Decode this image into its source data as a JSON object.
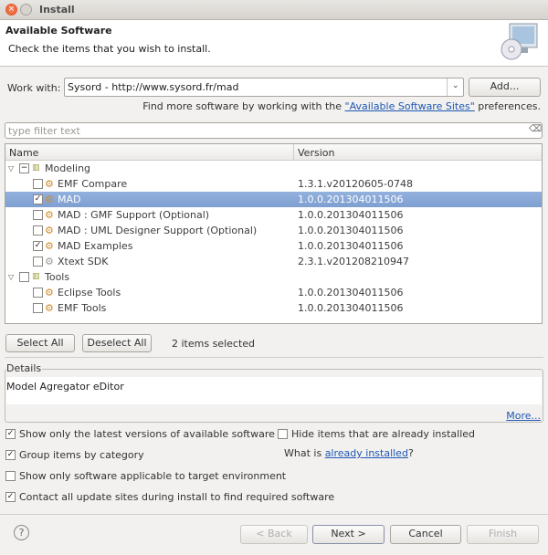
{
  "window": {
    "title": "Install"
  },
  "header": {
    "title": "Available Software",
    "description": "Check the items that you wish to install.",
    "icon": "install-cd-monitor-icon"
  },
  "work_with": {
    "label": "Work with:",
    "value": "Sysord - http://www.sysord.fr/mad",
    "add_label": "Add...",
    "find_more_prefix": "Find more software by working with the ",
    "find_more_link": "\"Available Software Sites\"",
    "find_more_suffix": " preferences."
  },
  "filter": {
    "placeholder": "type filter text"
  },
  "table": {
    "columns": [
      "Name",
      "Version"
    ],
    "rows": [
      {
        "name": "Modeling",
        "version": "",
        "type": "category",
        "checked": "partial",
        "expanded": true
      },
      {
        "name": "EMF Compare",
        "version": "1.3.1.v20120605-0748",
        "checked": false
      },
      {
        "name": "MAD",
        "version": "1.0.0.201304011506",
        "checked": true,
        "selected": true
      },
      {
        "name": "MAD : GMF Support (Optional)",
        "version": "1.0.0.201304011506",
        "checked": false
      },
      {
        "name": "MAD : UML Designer Support (Optional)",
        "version": "1.0.0.201304011506",
        "checked": false
      },
      {
        "name": "MAD Examples",
        "version": "1.0.0.201304011506",
        "checked": true
      },
      {
        "name": "Xtext SDK",
        "version": "2.3.1.v201208210947",
        "checked": false
      },
      {
        "name": "Tools",
        "version": "",
        "type": "category",
        "checked": false,
        "expanded": true
      },
      {
        "name": "Eclipse Tools",
        "version": "1.0.0.201304011506",
        "checked": false
      },
      {
        "name": "EMF Tools",
        "version": "1.0.0.201304011506",
        "checked": false
      }
    ]
  },
  "selection": {
    "select_all": "Select All",
    "deselect_all": "Deselect All",
    "status": "2 items selected"
  },
  "details": {
    "label": "Details",
    "text": "Model Agregator eDitor",
    "more": "More..."
  },
  "options": {
    "latest": {
      "label": "Show only the latest versions of available software",
      "checked": true
    },
    "group": {
      "label": "Group items by category",
      "checked": true
    },
    "target": {
      "label": "Show only software applicable to target environment",
      "checked": false
    },
    "contact": {
      "label": "Contact all update sites during install to find required software",
      "checked": true
    },
    "hide": {
      "label": "Hide items that are already installed",
      "checked": false
    },
    "what_is_prefix": "What is ",
    "what_is_link": "already installed",
    "what_is_suffix": "?"
  },
  "footer": {
    "back": "< Back",
    "next": "Next >",
    "cancel": "Cancel",
    "finish": "Finish"
  }
}
